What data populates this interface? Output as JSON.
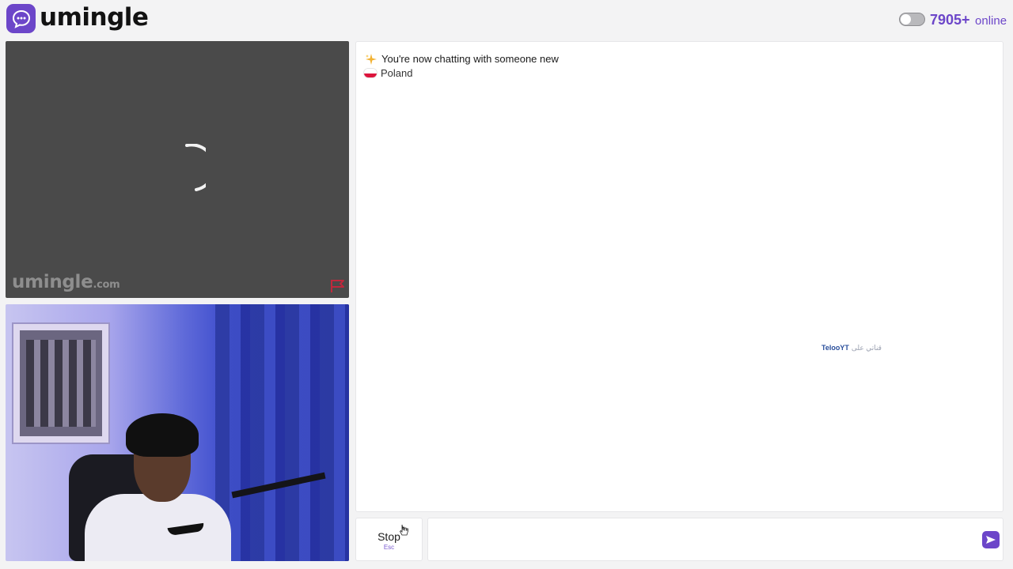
{
  "app": {
    "name": "umingle",
    "online_count": "7905",
    "online_plus": "+",
    "online_label": "online"
  },
  "stranger_video": {
    "watermark_name": "umingle",
    "watermark_tld": ".com",
    "report_icon": "flag-icon",
    "loading": true
  },
  "chat": {
    "status_icon": "sparkle-icon",
    "status_text": "You're now chatting with someone new",
    "country_icon": "poland-flag-icon",
    "country_name": "Poland",
    "overlay_text_a": "TelooYT",
    "overlay_text_b": "قناتي على"
  },
  "controls": {
    "stop_label": "Stop",
    "stop_shortcut": "Esc",
    "message_placeholder": "",
    "send_icon": "send-icon"
  },
  "colors": {
    "brand": "#6c46c9",
    "video_bg": "#4a4a4a",
    "report_flag": "#c0283c"
  }
}
